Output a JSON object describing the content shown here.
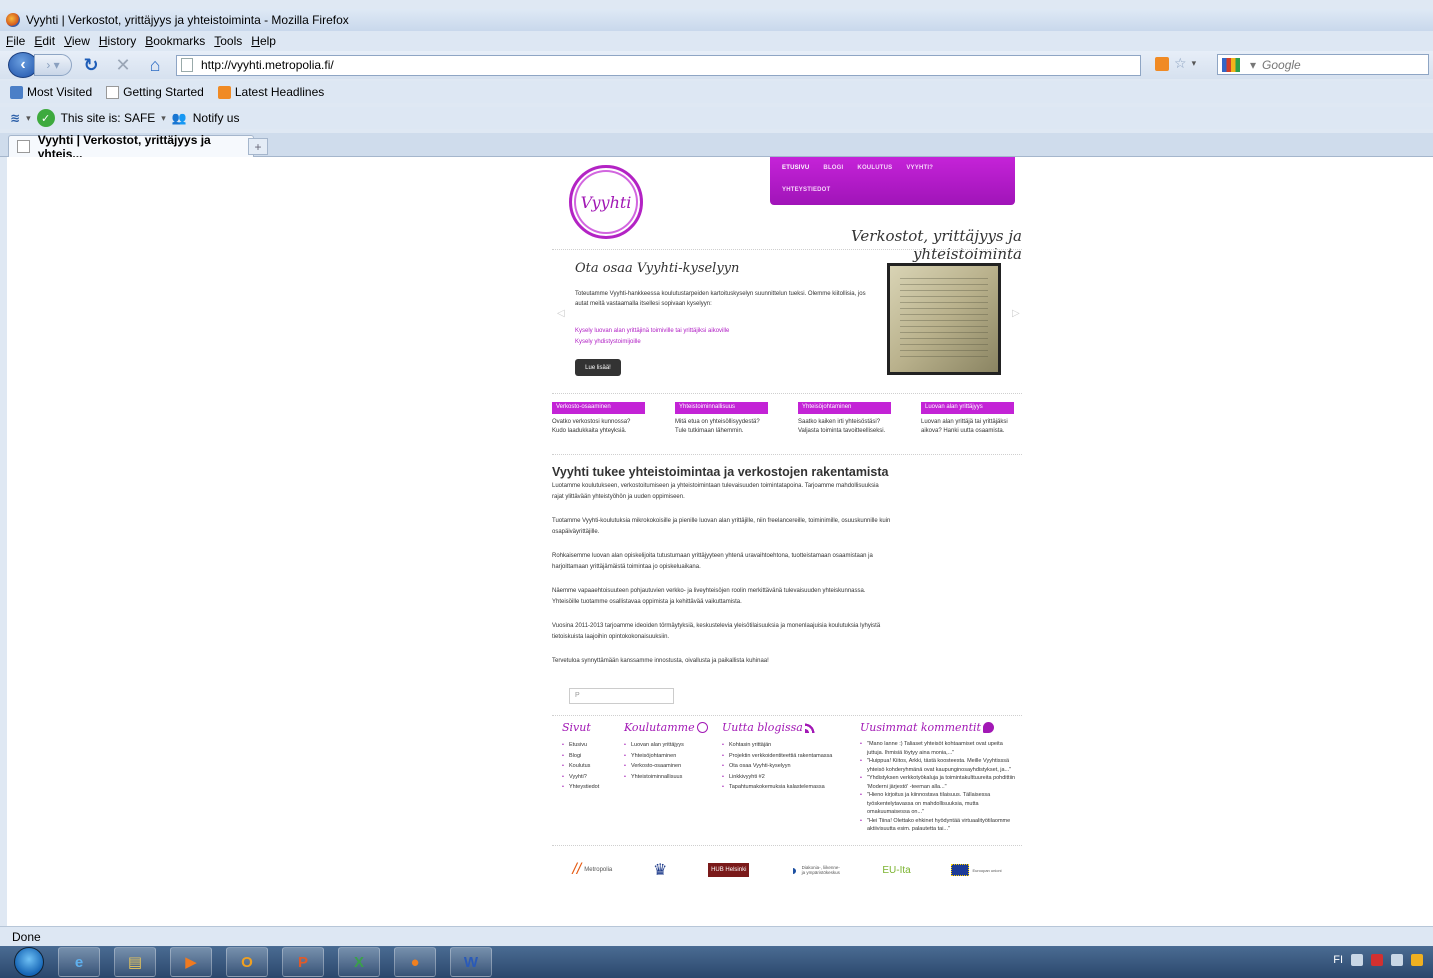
{
  "window": {
    "title": "Vyyhti | Verkostot, yrittäjyys ja yhteistoiminta - Mozilla Firefox"
  },
  "menubar": [
    "File",
    "Edit",
    "View",
    "History",
    "Bookmarks",
    "Tools",
    "Help"
  ],
  "navbar": {
    "url": "http://vyyhti.metropolia.fi/",
    "search_placeholder": "Google"
  },
  "bookmarks": [
    "Most Visited",
    "Getting Started",
    "Latest Headlines"
  ],
  "wot": {
    "safe_text": "This site is: SAFE",
    "notify": "Notify us"
  },
  "tab": {
    "title": "Vyyhti | Verkostot, yrittäjyys ja yhteis...",
    "new_tab": "+"
  },
  "status": "Done",
  "site": {
    "logo_text": "Vyyhti",
    "nav": {
      "row1": [
        "ETUSIVU",
        "BLOGI",
        "KOULUTUS",
        "VYYHTI?"
      ],
      "row2": [
        "YHTEYSTIEDOT"
      ]
    },
    "tagline": "Verkostot, yrittäjyys ja yhteistoiminta",
    "slider": {
      "title": "Ota osaa Vyyhti-kyselyyn",
      "text": "Toteutamme Vyyhti-hankkeessa koulutustarpeiden kartoituskyselyn suunnittelun tueksi. Olemme kiitollisia, jos autat meitä vastaamalla itsellesi sopivaan kyselyyn:",
      "link1": "Kysely luovan alan yrittäjinä toimiville tai yrittäjiksi aikoville",
      "link2": "Kysely yhdistystoimijoille",
      "button": "Lue lisää!",
      "prev": "◁",
      "next": "▷"
    },
    "boxes": [
      {
        "title": "Verkosto-osaaminen",
        "text": "Ovatko verkostosi kunnossa? Kudo laadukkaita yhteyksiä."
      },
      {
        "title": "Yhteistoiminnallisuus",
        "text": "Mitä etua on yhteisöllisyydestä? Tule tutkimaan lähemmin."
      },
      {
        "title": "Yhteisöjohtaminen",
        "text": "Saatko kaiken irti yhteisöstäsi? Valjasta toiminta tavoitteelliseksi."
      },
      {
        "title": "Luovan alan yrittäjyys",
        "text": "Luovan alan yrittäjä tai yrittäjäksi aikova? Hanki uutta osaamista."
      }
    ],
    "main": {
      "heading": "Vyyhti tukee yhteistoimintaa ja verkostojen rakentamista",
      "paragraphs": [
        "Luotamme koulutukseen, verkostoitumiseen ja yhteistoimintaan tulevaisuuden toimintatapoina. Tarjoamme mahdollisuuksia rajat ylittävään yhteistyöhön ja uuden oppimiseen.",
        "Tuotamme Vyyhti-koulutuksia mikrokokoisille ja pienille luovan alan yrittäjille, niin freelancereille, toiminimille, osuuskunnille kuin osapäiväyrittäjille.",
        "Rohkaisemme luovan alan opiskelijoita tutustumaan yrittäjyyteen yhtenä uravaihtoehtona, tuotteistamaan osaamistaan ja harjoittamaan yrittäjämäistä toimintaa jo opiskeluaikana.",
        "Näemme vapaaehtoisuuteen pohjautuvien verkko- ja liveyhteisöjen roolin merkittävänä tulevaisuuden yhteiskunnassa. Yhteisöille tuotamme osallistavaa oppimista ja kehittävää vaikuttamista.",
        "Vuosina 2011-2013 tarjoamme ideoiden törmäytyksiä, keskustelevia yleisötilaisuuksia ja monenlaajuisia koulutuksia lyhyistä tietoiskuista laajoihin opintokokonaisuuksiin.",
        "Tervetuloa synnyttämään kanssamme innostusta, oivallusta ja paikallista kuhinaa!"
      ]
    },
    "search_placeholder": "P",
    "footer": {
      "sivut": {
        "title": "Sivut",
        "items": [
          "Etusivu",
          "Blogi",
          "Koulutus",
          "Vyyhti?",
          "Yhteystiedot"
        ]
      },
      "koulutamme": {
        "title": "Koulutamme",
        "items": [
          "Luovan alan yrittäjyys",
          "Yhteisöjohtaminen",
          "Verkosto-osaaminen",
          "Yhteistoiminnallisuus"
        ]
      },
      "blogi": {
        "title": "Uutta blogissa",
        "items": [
          "Kohtasin yrittäjän",
          "Projektin verkkoidentiteettiä rakentamassa",
          "Ota osaa Vyyhti-kyselyyn",
          "Linkkivyyhti #2",
          "Tapahtumakokemuksia kalastelemassa"
        ]
      },
      "kommentit": {
        "title": "Uusimmat kommentit",
        "items": [
          "\"Mano lanne :) Taliaset yhteisöt kohtaamiset ovat upeita juttuja. Ihmisiä löytyy aina monia,...\"",
          "\"Huippua! Kiitos, Arkki, tästä koosteesta. Meille Vyyhtisssä yhteisö kohderyhmänä ovat kaupunginosayhdistykset, ja...\"",
          "\"Yhdistyksen verkkotyökaluja ja toimintakulttuureita pohdittiin 'Moderni järjestö' -teeman alla...\"",
          "\"Hieno kirjoitus ja kiinnostava tilaisuus. Tällaisessa työskentelytavassa on mahdollisuuksia, mutta omakuumaisessa on...\"",
          "\"Hei Tiina! Olettako ehkinet hyödyntää virtuaalityötilaomme aktiivisuutta esim. palautetta tai...\""
        ]
      }
    },
    "logos": [
      "Metropolia",
      "HUB Helsinki",
      "Diakonia-, liikenne- ja ympäristökeskus",
      "EU-Ita",
      "Euroopan unioni"
    ]
  },
  "colors": {
    "accent": "#b323c4",
    "nav_bg": "#c523d8"
  }
}
